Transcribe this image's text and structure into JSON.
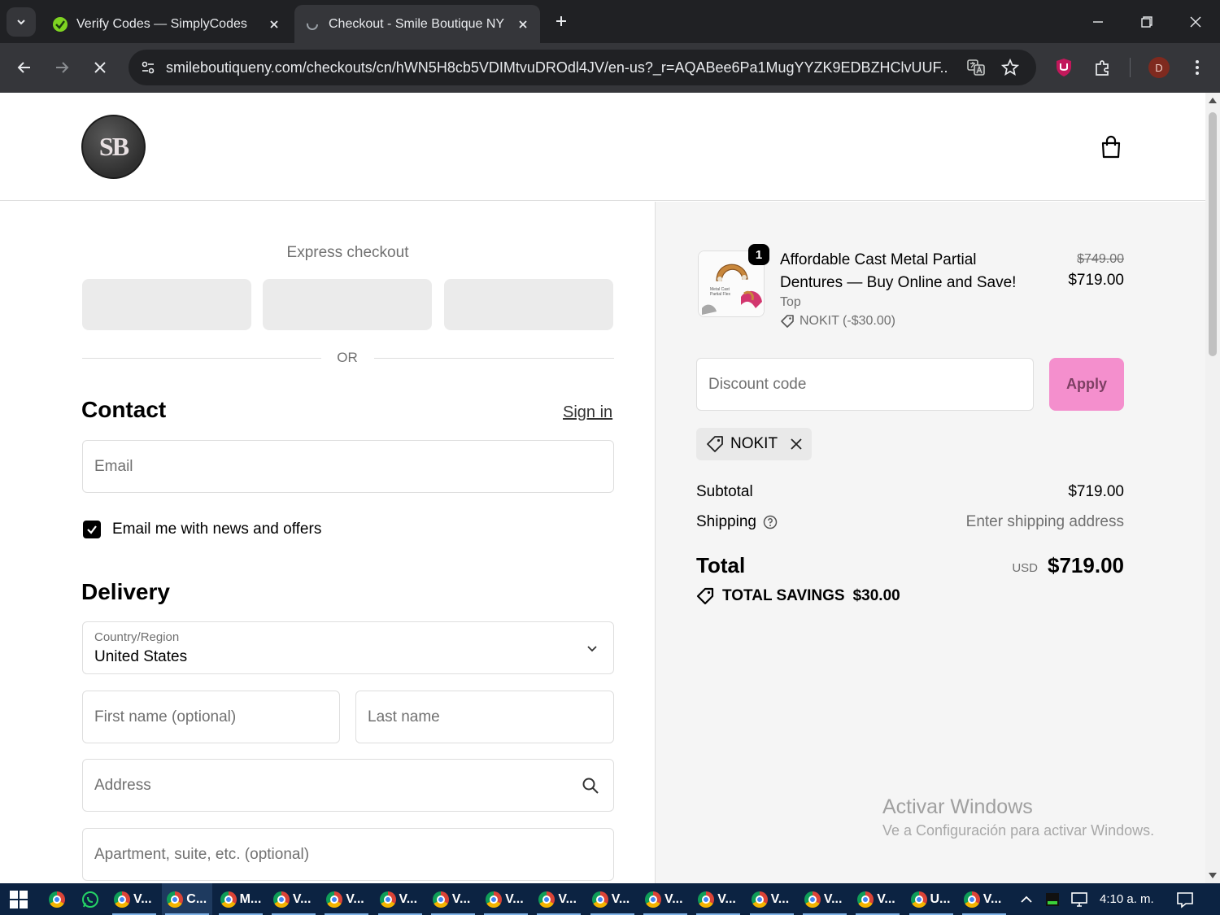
{
  "browser": {
    "tabs": [
      {
        "title": "Verify Codes — SimplyCodes",
        "active": false
      },
      {
        "title": "Checkout - Smile Boutique NY",
        "active": true
      }
    ],
    "url": "smileboutiqueny.com/checkouts/cn/hWN5H8cb5VDIMtvuDROdl4JV/en-us?_r=AQABee6Pa1MugYYZK9EDBZHClvUUF...",
    "profile_initial": "D"
  },
  "store": {
    "logo_text": "SB"
  },
  "checkout": {
    "express_label": "Express checkout",
    "or_label": "OR",
    "contact": {
      "heading": "Contact",
      "sign_in": "Sign in",
      "email_placeholder": "Email",
      "newsletter_label": "Email me with news and offers",
      "newsletter_checked": true
    },
    "delivery": {
      "heading": "Delivery",
      "country_label": "Country/Region",
      "country_value": "United States",
      "first_name_placeholder": "First name (optional)",
      "last_name_placeholder": "Last name",
      "address_placeholder": "Address",
      "apartment_placeholder": "Apartment, suite, etc. (optional)"
    }
  },
  "summary": {
    "item": {
      "quantity": "1",
      "name": "Affordable Cast Metal Partial Dentures — Buy Online and Save!",
      "variant": "Top",
      "discount": "NOKIT (-$30.00)",
      "price_original": "$749.00",
      "price": "$719.00"
    },
    "discount_placeholder": "Discount code",
    "apply_label": "Apply",
    "applied_code": "NOKIT",
    "subtotal_label": "Subtotal",
    "subtotal_value": "$719.00",
    "shipping_label": "Shipping",
    "shipping_value": "Enter shipping address",
    "total_label": "Total",
    "total_currency": "USD",
    "total_value": "$719.00",
    "savings_label": "TOTAL SAVINGS",
    "savings_value": "$30.00",
    "accent_color": "#f48fcd"
  },
  "watermark": {
    "title": "Activar Windows",
    "subtitle": "Ve a Configuración para activar Windows."
  },
  "taskbar": {
    "items": [
      {
        "label": "V..."
      },
      {
        "label": "C..."
      },
      {
        "label": "M..."
      },
      {
        "label": "V..."
      },
      {
        "label": "V..."
      },
      {
        "label": "V..."
      },
      {
        "label": "V..."
      },
      {
        "label": "V..."
      },
      {
        "label": "V..."
      },
      {
        "label": "V..."
      },
      {
        "label": "V..."
      },
      {
        "label": "V..."
      },
      {
        "label": "V..."
      },
      {
        "label": "V..."
      },
      {
        "label": "V..."
      },
      {
        "label": "U..."
      },
      {
        "label": "V..."
      }
    ],
    "clock": "4:10 a. m."
  }
}
